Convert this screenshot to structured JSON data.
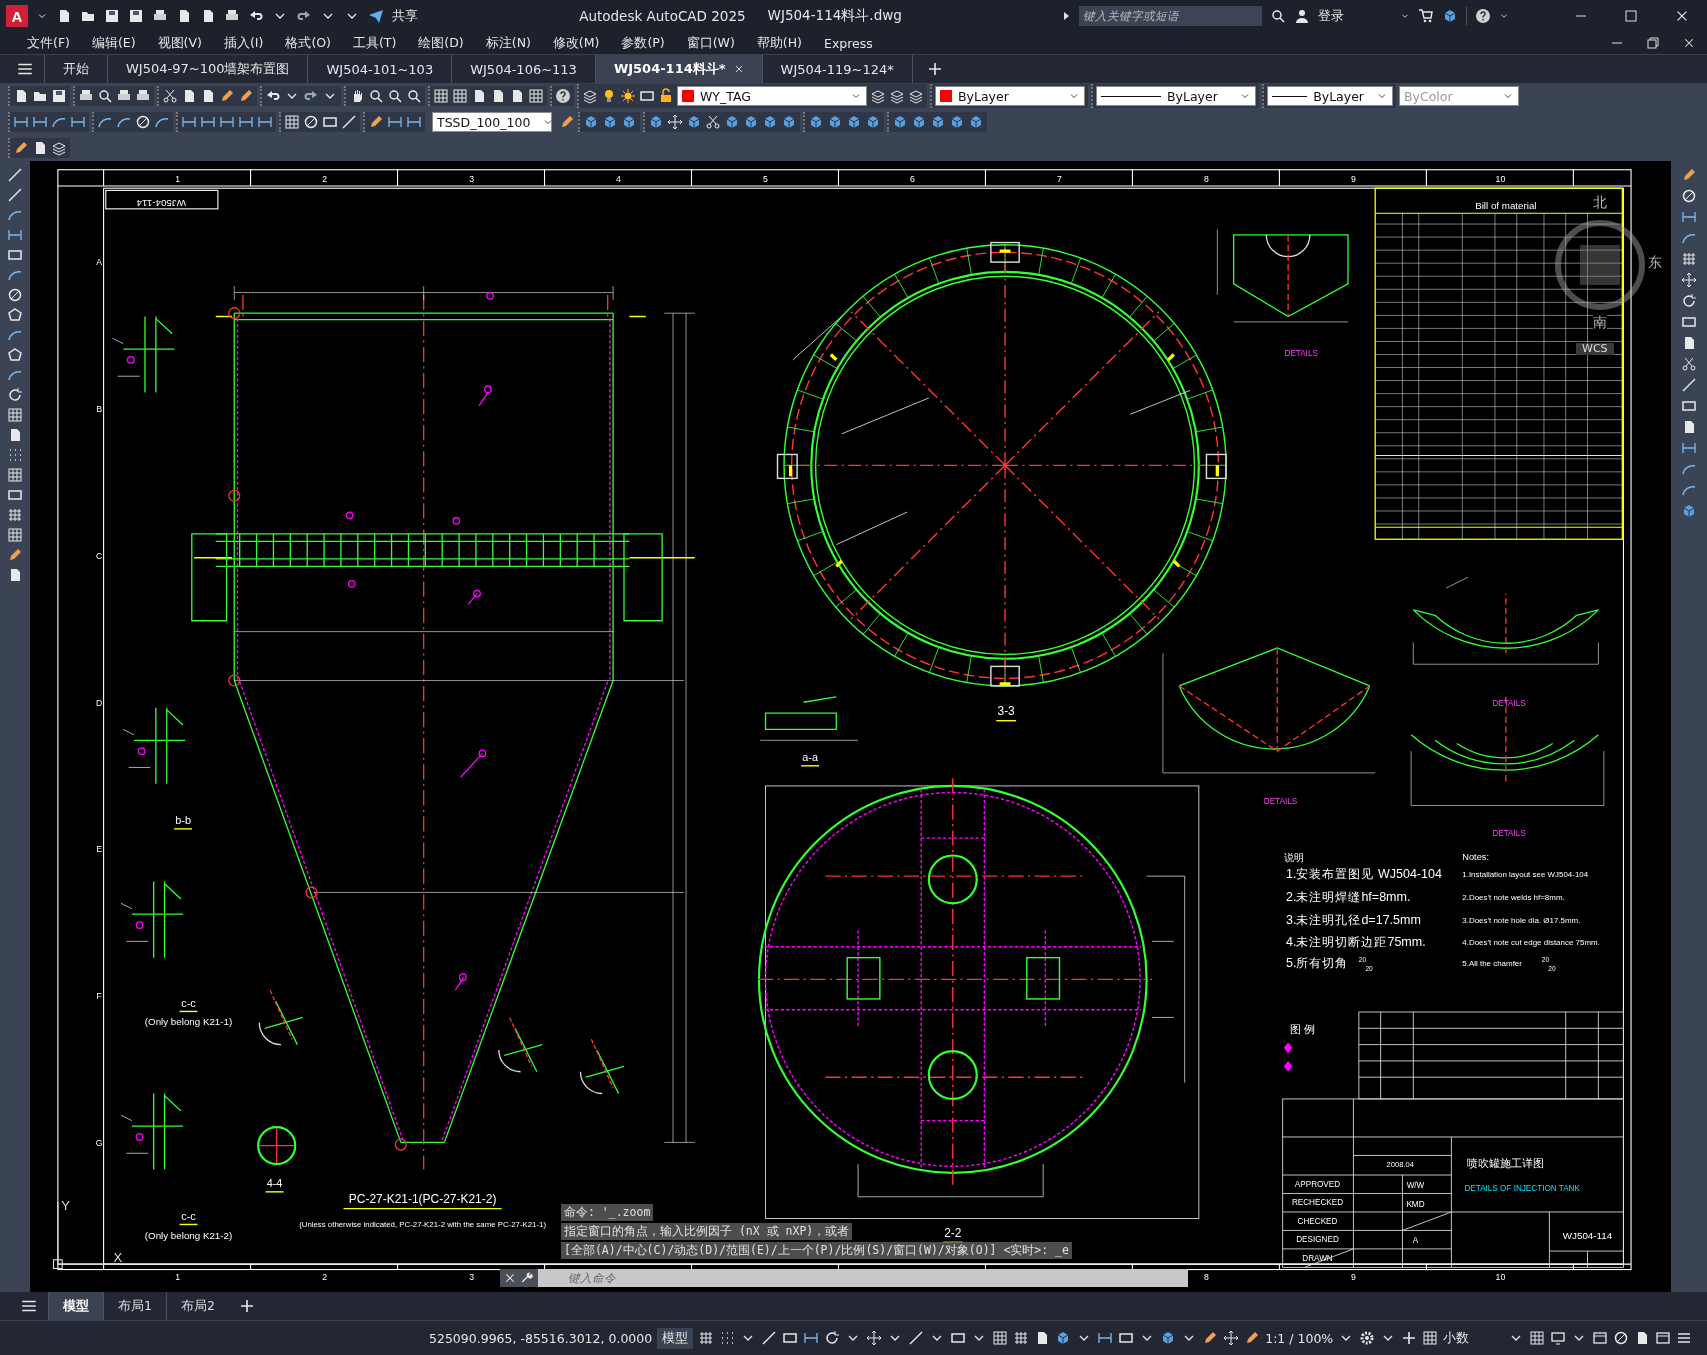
{
  "title_bar": {
    "app_letter": "A",
    "share": "共享",
    "app_name": "Autodesk AutoCAD 2025",
    "file_name": "WJ504-114料斗.dwg",
    "search": {
      "placeholder": "键入关键字或短语"
    },
    "sign_in": "登录"
  },
  "menu_bar": [
    "文件(F)",
    "编辑(E)",
    "视图(V)",
    "插入(I)",
    "格式(O)",
    "工具(T)",
    "绘图(D)",
    "标注(N)",
    "修改(M)",
    "参数(P)",
    "窗口(W)",
    "帮助(H)",
    "Express"
  ],
  "file_tabs": [
    {
      "label": "开始",
      "selected": false
    },
    {
      "label": "WJ504-97~100墙架布置图",
      "selected": false
    },
    {
      "label": "WJ504-101~103",
      "selected": false
    },
    {
      "label": "WJ504-106~113",
      "selected": false
    },
    {
      "label": "WJ504-114料斗*",
      "selected": true
    },
    {
      "label": "WJ504-119~124*",
      "selected": false
    }
  ],
  "toolbars": {
    "layer": "WY_TAG",
    "color_control": "ByLayer",
    "linetype": "ByLayer",
    "lineweight": "ByLayer",
    "plot_style": {
      "label": "ByColor",
      "disabled": true
    },
    "dim_style": "TSSD_100_100"
  },
  "drawing": {
    "column_numbers": [
      "1",
      "2",
      "3",
      "4",
      "5",
      "6",
      "7",
      "8",
      "9",
      "10"
    ],
    "bottom_column_numbers": [
      "1",
      "2",
      "3",
      "8",
      "9",
      "10"
    ],
    "row_letters": [
      "A",
      "B",
      "C",
      "D",
      "E",
      "F",
      "G"
    ],
    "sheet_tag": "WJ504-114",
    "labels": [
      {
        "text": "3-3",
        "underlined": true
      },
      {
        "text": "a-a",
        "underlined": true
      },
      {
        "text": "b-b",
        "underlined": true
      },
      {
        "text": "c-c",
        "underlined": true
      },
      {
        "text": "(Only belong K21-1)",
        "underlined": false
      },
      {
        "text": "c-c",
        "underlined": true
      },
      {
        "text": "(Only belong K21-2)",
        "underlined": false
      },
      {
        "text": "4-4",
        "underlined": true
      },
      {
        "text": "PC-27-K21-1(PC-27-K21-2)",
        "underlined": true
      },
      {
        "text": "(Unless otherwise indicated, PC-27-K21-2 with the same  PC-27-K21-1)",
        "underlined": false
      },
      {
        "text": "2-2",
        "underlined": true
      },
      {
        "text": "Bill of material",
        "underlined": false
      },
      {
        "text": "DETAILS",
        "underlined": false
      },
      {
        "text": "DETAILS",
        "underlined": false
      },
      {
        "text": "DETAILS",
        "underlined": false
      },
      {
        "text": "DETAILS",
        "underlined": false
      },
      {
        "text": "图 例",
        "underlined": false
      }
    ],
    "notes_cn": [
      "说明",
      "1.安装布置图见  WJ504-104",
      "2.未注明焊缝hf=8mm.",
      "3.未注明孔径d=17.5mm",
      "4.未注明切断边距75mm.",
      "5.所有切角"
    ],
    "notes_en": [
      "Notes:",
      "1.Installation layout see WJ504-104",
      "2.Does't note welds hf=8mm.",
      "3.Does't note hole dia. Ø17.5mm.",
      "4.Does't note cut edge distance 75mm.",
      "5.All the chamfer"
    ],
    "chamfer_marks": [
      "20",
      "20",
      "20",
      "20"
    ],
    "title_block": {
      "title_cn": "喷吹罐施工详图",
      "title_en": "DETAILS OF INJECTION TANK",
      "drawing_no": "WJ504-114",
      "date": "2008.04",
      "project_no": "W/W",
      "stage": "KMD",
      "revision": "A",
      "roles": [
        "APPROVED",
        "RECHECKED",
        "CHECKED",
        "DESIGNED",
        "DRAWN"
      ]
    },
    "ucs_axes": [
      "Y",
      "X"
    ],
    "viewcube": {
      "north": "北",
      "east": "东",
      "south": "南",
      "wcs": "WCS"
    }
  },
  "command_line": {
    "history": [
      "命令: '_.zoom",
      "指定窗口的角点，输入比例因子 (nX 或 nXP)，或者",
      "[全部(A)/中心(C)/动态(D)/范围(E)/上一个(P)/比例(S)/窗口(W)/对象(O)] <实时>: _e"
    ],
    "placeholder": "键入命令"
  },
  "layout_tabs": [
    {
      "label": "模型",
      "selected": true
    },
    {
      "label": "布局1",
      "selected": false
    },
    {
      "label": "布局2",
      "selected": false
    }
  ],
  "status_bar": {
    "coordinates": "525090.9965, -85516.3012, 0.0000",
    "space": "模型",
    "scale": "1:1 / 100%",
    "units": "小数"
  }
}
